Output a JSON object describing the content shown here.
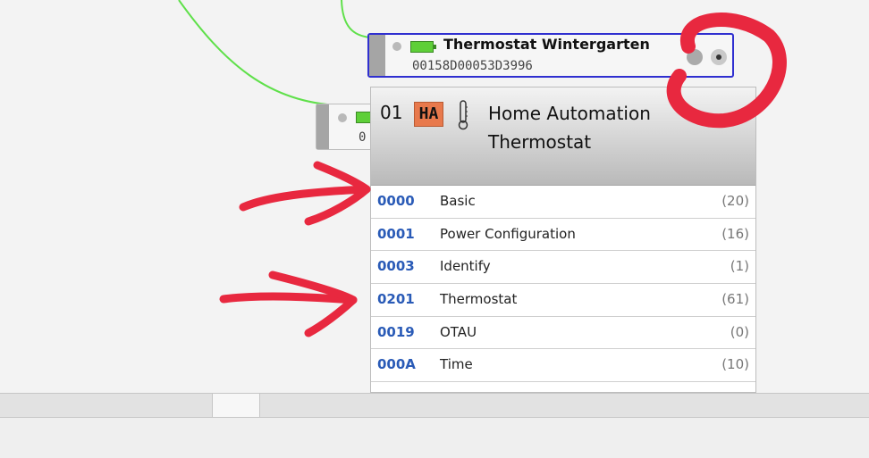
{
  "nodes": {
    "main": {
      "title": "Thermostat Wintergarten",
      "mac": "00158D00053D3996"
    },
    "back": {
      "mac": "0"
    }
  },
  "endpoint": {
    "number": "01",
    "profile_badge": "HA",
    "profile_name": "Home Automation Thermostat",
    "clusters": [
      {
        "id": "0000",
        "name": "Basic",
        "count": "(20)"
      },
      {
        "id": "0001",
        "name": "Power Configuration",
        "count": "(16)"
      },
      {
        "id": "0003",
        "name": "Identify",
        "count": "(1)"
      },
      {
        "id": "0201",
        "name": "Thermostat",
        "count": "(61)"
      },
      {
        "id": "0019",
        "name": "OTAU",
        "count": "(0)"
      },
      {
        "id": "000A",
        "name": "Time",
        "count": "(10)"
      }
    ]
  },
  "colors": {
    "selected_border": "#2f2fd0",
    "cluster_id": "#2a5bb7",
    "ha_badge": "#e8794c",
    "battery": "#5ecf38",
    "link": "#5fe04a",
    "annotation": "#e8283f"
  },
  "icons": [
    "battery-icon",
    "thermometer-icon",
    "node-status-dot-icon",
    "node-action-button-icon"
  ]
}
